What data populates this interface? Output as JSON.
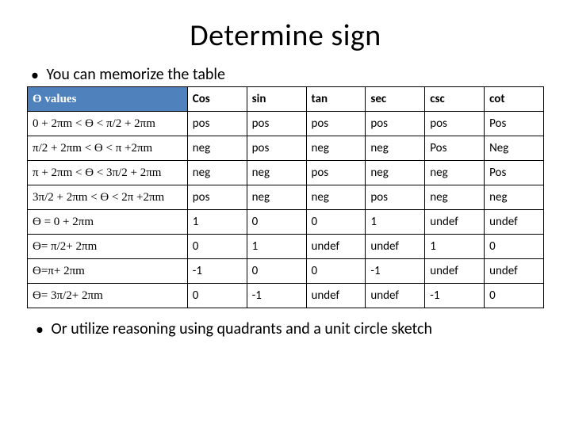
{
  "title": "Determine sign",
  "bullet_top": "You can memorize the table",
  "bullet_bottom": "Or utilize reasoning using quadrants and a unit circle sketch",
  "table": {
    "header": {
      "theta": "Ө values",
      "fns": [
        "Cos",
        "sin",
        "tan",
        "sec",
        "csc",
        "cot"
      ]
    },
    "rows": [
      {
        "label": "0 + 2πm  <  Ө  <   π/2  +  2πm",
        "cells": [
          "pos",
          "pos",
          "pos",
          "pos",
          "pos",
          "Pos"
        ]
      },
      {
        "label": "π/2  +  2πm  < Ө  < π +2πm",
        "cells": [
          "neg",
          "pos",
          "neg",
          "neg",
          "Pos",
          "Neg"
        ]
      },
      {
        "label": "π  +  2πm  <   Ө  <   3π/2  +  2πm",
        "cells": [
          "neg",
          "neg",
          "pos",
          "neg",
          "neg",
          "Pos"
        ]
      },
      {
        "label": " 3π/2  +  2πm < Ө <   2π +2πm",
        "cells": [
          "pos",
          "neg",
          "neg",
          "pos",
          "neg",
          "neg"
        ]
      },
      {
        "label": "Ө = 0 + 2πm",
        "cells": [
          "1",
          "0",
          "0",
          "1",
          "undef",
          "undef"
        ]
      },
      {
        "label": "Ө=  π/2+ 2πm",
        "cells": [
          "0",
          "1",
          "undef",
          "undef",
          "1",
          "0"
        ]
      },
      {
        "label": "Ө=π+ 2πm",
        "cells": [
          "-1",
          "0",
          "0",
          "-1",
          "undef",
          "undef"
        ]
      },
      {
        "label": "Ө= 3π/2+ 2πm",
        "cells": [
          "0",
          "-1",
          "undef",
          "undef",
          "-1",
          "0"
        ]
      }
    ]
  },
  "chart_data": {
    "type": "table",
    "title": "Determine sign",
    "columns": [
      "Ө values",
      "Cos",
      "sin",
      "tan",
      "sec",
      "csc",
      "cot"
    ],
    "rows": [
      [
        "0 + 2πm < Ө < π/2 + 2πm",
        "pos",
        "pos",
        "pos",
        "pos",
        "pos",
        "Pos"
      ],
      [
        "π/2 + 2πm < Ө < π + 2πm",
        "neg",
        "pos",
        "neg",
        "neg",
        "Pos",
        "Neg"
      ],
      [
        "π + 2πm < Ө < 3π/2 + 2πm",
        "neg",
        "neg",
        "pos",
        "neg",
        "neg",
        "Pos"
      ],
      [
        "3π/2 + 2πm < Ө < 2π + 2πm",
        "pos",
        "neg",
        "neg",
        "pos",
        "neg",
        "neg"
      ],
      [
        "Ө = 0 + 2πm",
        "1",
        "0",
        "0",
        "1",
        "undef",
        "undef"
      ],
      [
        "Ө = π/2 + 2πm",
        "0",
        "1",
        "undef",
        "undef",
        "1",
        "0"
      ],
      [
        "Ө = π + 2πm",
        "-1",
        "0",
        "0",
        "-1",
        "undef",
        "undef"
      ],
      [
        "Ө = 3π/2 + 2πm",
        "0",
        "-1",
        "undef",
        "undef",
        "-1",
        "0"
      ]
    ]
  }
}
